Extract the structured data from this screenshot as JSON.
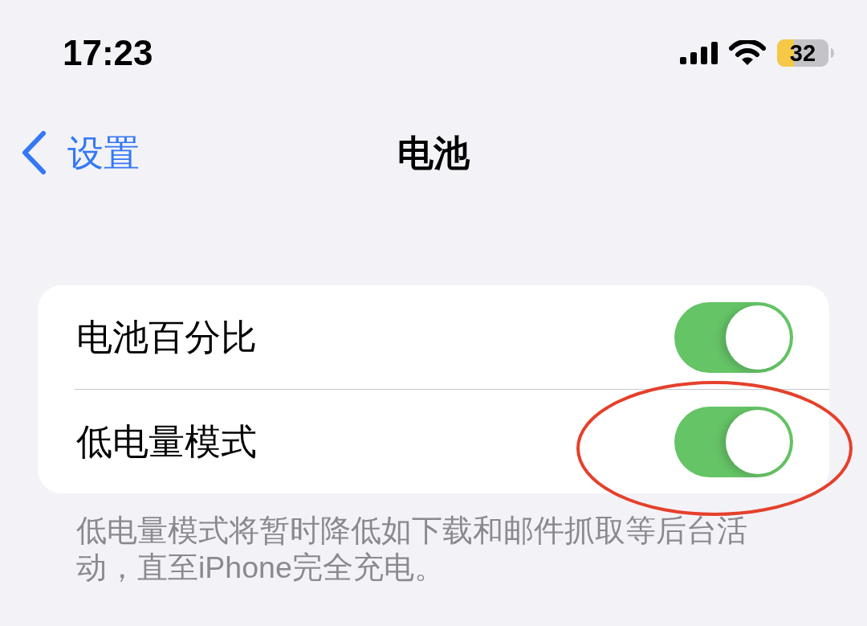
{
  "status_bar": {
    "time": "17:23",
    "battery_reading": "32"
  },
  "nav": {
    "back_label": "设置",
    "title": "电池"
  },
  "rows": [
    {
      "label": "电池百分比",
      "on": true,
      "highlighted": false
    },
    {
      "label": "低电量模式",
      "on": true,
      "highlighted": true
    }
  ],
  "footer": "低电量模式将暂时降低如下载和邮件抓取等后台活动，直至iPhone完全充电。"
}
